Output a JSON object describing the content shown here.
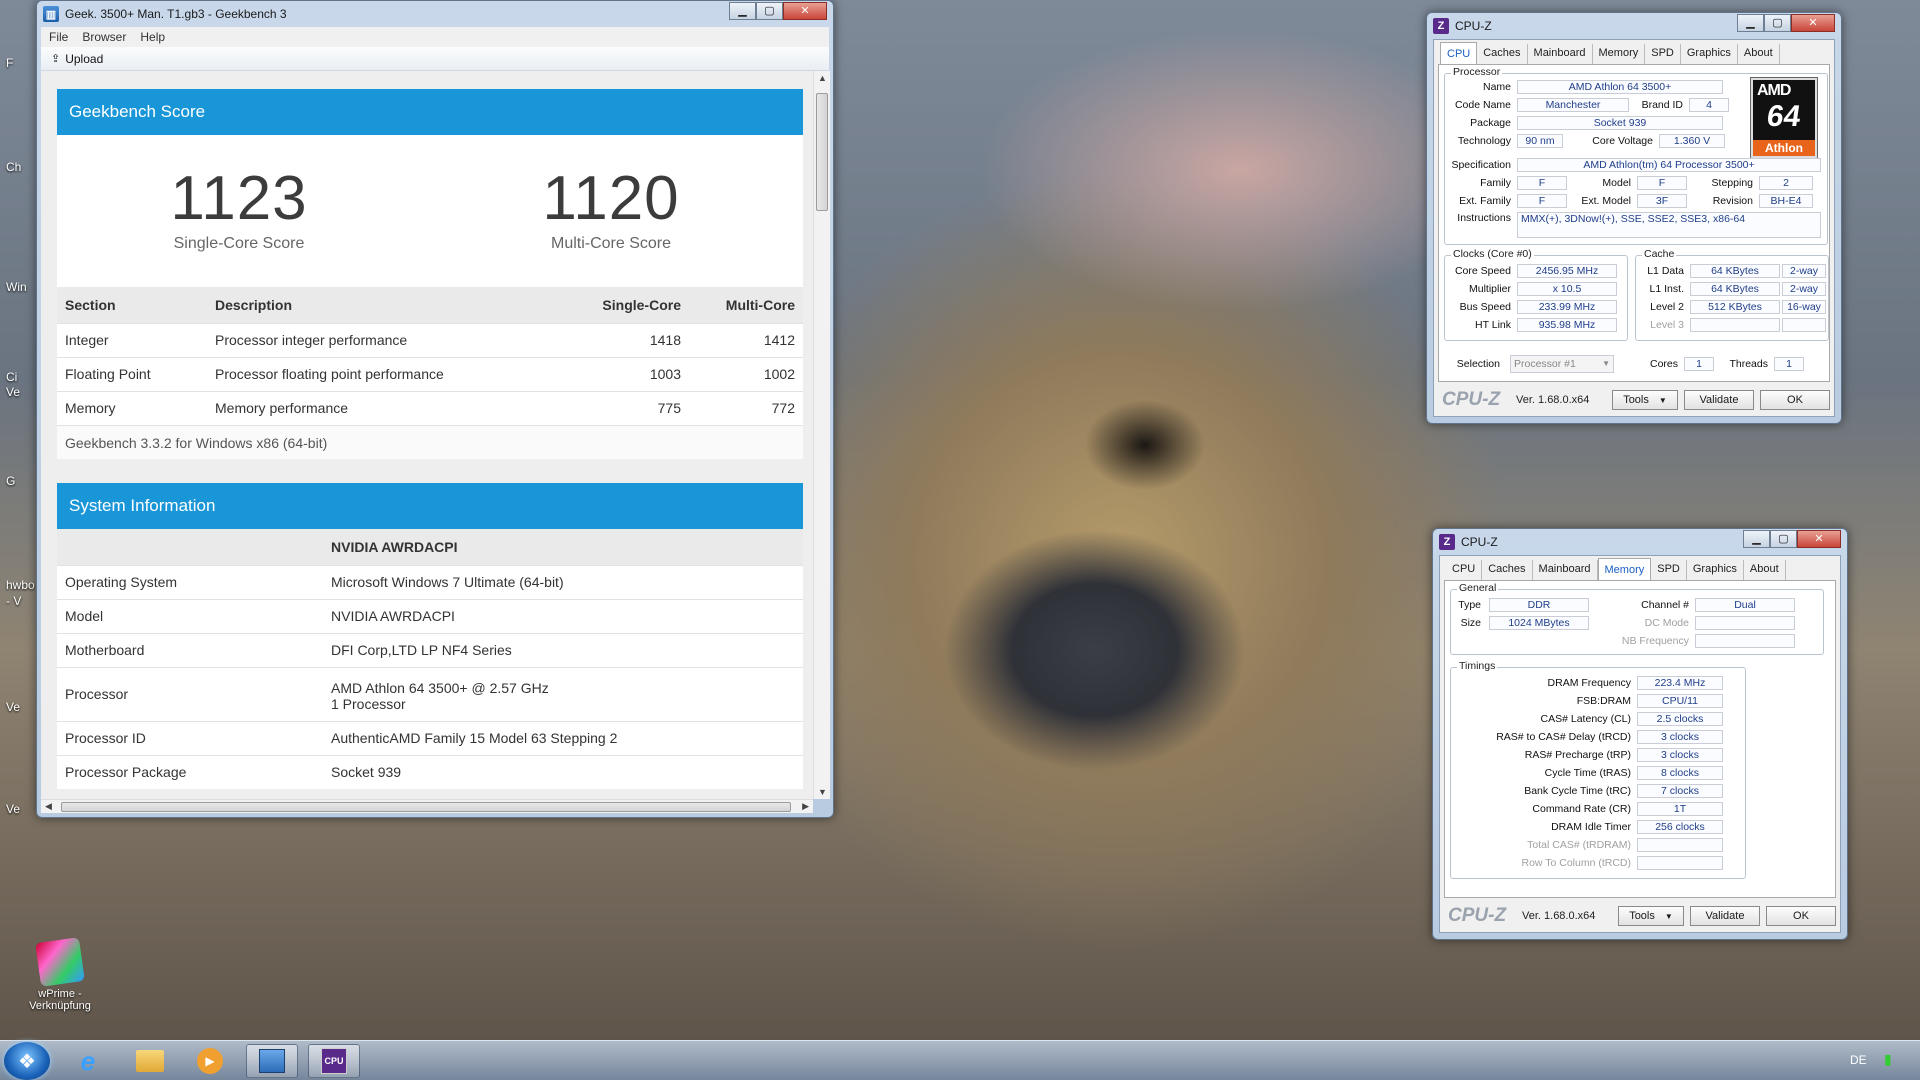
{
  "desktop": {
    "icon_label": "wPrime - Verknüpfung",
    "left_edge_fragments": [
      "F",
      "Ch",
      "Win",
      "Ci",
      "Ve",
      "G",
      "hwbo",
      "- V",
      "Ve",
      "Ve"
    ]
  },
  "geekbench": {
    "title": "Geek. 3500+ Man. T1.gb3 - Geekbench 3",
    "menu": [
      "File",
      "Browser",
      "Help"
    ],
    "toolbar_upload": "Upload",
    "score_card": {
      "header": "Geekbench Score",
      "single_score": "1123",
      "single_label": "Single-Core Score",
      "multi_score": "1120",
      "multi_label": "Multi-Core Score",
      "columns": [
        "Section",
        "Description",
        "Single-Core",
        "Multi-Core"
      ],
      "rows": [
        {
          "section": "Integer",
          "description": "Processor integer performance",
          "single": "1418",
          "multi": "1412"
        },
        {
          "section": "Floating Point",
          "description": "Processor floating point performance",
          "single": "1003",
          "multi": "1002"
        },
        {
          "section": "Memory",
          "description": "Memory performance",
          "single": "775",
          "multi": "772"
        }
      ],
      "footnote": "Geekbench 3.3.2 for Windows x86 (64-bit)"
    },
    "sysinfo": {
      "header": "System Information",
      "machine": "NVIDIA AWRDACPI",
      "rows": [
        {
          "key": "Operating System",
          "value": "Microsoft Windows 7 Ultimate (64-bit)",
          "value2": ""
        },
        {
          "key": "Model",
          "value": "NVIDIA AWRDACPI",
          "value2": ""
        },
        {
          "key": "Motherboard",
          "value": "DFI Corp,LTD LP NF4 Series",
          "value2": ""
        },
        {
          "key": "Processor",
          "value": "AMD Athlon 64 3500+ @ 2.57 GHz",
          "value2": "1 Processor"
        },
        {
          "key": "Processor ID",
          "value": "AuthenticAMD Family 15 Model 63 Stepping 2",
          "value2": ""
        },
        {
          "key": "Processor Package",
          "value": "Socket 939",
          "value2": ""
        }
      ]
    }
  },
  "cpuz_common": {
    "title": "CPU-Z",
    "tabs": [
      "CPU",
      "Caches",
      "Mainboard",
      "Memory",
      "SPD",
      "Graphics",
      "About"
    ],
    "brand": "CPU-Z",
    "version": "Ver. 1.68.0.x64",
    "tools": "Tools",
    "validate": "Validate",
    "ok": "OK"
  },
  "cpuz_cpu": {
    "processor_group": "Processor",
    "name_label": "Name",
    "name": "AMD Athlon 64 3500+",
    "codename_label": "Code Name",
    "codename": "Manchester",
    "brandid_label": "Brand ID",
    "brandid": "4",
    "package_label": "Package",
    "package": "Socket 939",
    "technology_label": "Technology",
    "technology": "90 nm",
    "voltage_label": "Core Voltage",
    "voltage": "1.360 V",
    "spec_label": "Specification",
    "spec": "AMD Athlon(tm) 64 Processor 3500+",
    "family_label": "Family",
    "family": "F",
    "model_label": "Model",
    "model": "F",
    "stepping_label": "Stepping",
    "stepping": "2",
    "extfamily_label": "Ext. Family",
    "extfamily": "F",
    "extmodel_label": "Ext. Model",
    "extmodel": "3F",
    "revision_label": "Revision",
    "revision": "BH-E4",
    "instructions_label": "Instructions",
    "instructions": "MMX(+), 3DNow!(+), SSE, SSE2, SSE3, x86-64",
    "logo_top": "AMD",
    "logo_num": "64",
    "logo_bottom": "Athlon",
    "clocks_group": "Clocks (Core #0)",
    "corespeed_label": "Core Speed",
    "corespeed": "2456.95 MHz",
    "multiplier_label": "Multiplier",
    "multiplier": "x 10.5",
    "busspeed_label": "Bus Speed",
    "busspeed": "233.99 MHz",
    "htlink_label": "HT Link",
    "htlink": "935.98 MHz",
    "cache_group": "Cache",
    "l1d_label": "L1 Data",
    "l1d": "64 KBytes",
    "l1d_way": "2-way",
    "l1i_label": "L1 Inst.",
    "l1i": "64 KBytes",
    "l1i_way": "2-way",
    "l2_label": "Level 2",
    "l2": "512 KBytes",
    "l2_way": "16-way",
    "l3_label": "Level 3",
    "selection_label": "Selection",
    "selection": "Processor #1",
    "cores_label": "Cores",
    "cores": "1",
    "threads_label": "Threads",
    "threads": "1"
  },
  "cpuz_mem": {
    "general_group": "General",
    "type_label": "Type",
    "type": "DDR",
    "size_label": "Size",
    "size": "1024 MBytes",
    "channel_label": "Channel #",
    "channel": "Dual",
    "dcmode_label": "DC Mode",
    "nbfreq_label": "NB Frequency",
    "timings_group": "Timings",
    "timings": [
      {
        "label": "DRAM Frequency",
        "value": "223.4 MHz",
        "dim": false
      },
      {
        "label": "FSB:DRAM",
        "value": "CPU/11",
        "dim": false
      },
      {
        "label": "CAS# Latency (CL)",
        "value": "2.5 clocks",
        "dim": false
      },
      {
        "label": "RAS# to CAS# Delay (tRCD)",
        "value": "3 clocks",
        "dim": false
      },
      {
        "label": "RAS# Precharge (tRP)",
        "value": "3 clocks",
        "dim": false
      },
      {
        "label": "Cycle Time (tRAS)",
        "value": "8 clocks",
        "dim": false
      },
      {
        "label": "Bank Cycle Time (tRC)",
        "value": "7 clocks",
        "dim": false
      },
      {
        "label": "Command Rate (CR)",
        "value": "1T",
        "dim": false
      },
      {
        "label": "DRAM Idle Timer",
        "value": "256 clocks",
        "dim": false
      },
      {
        "label": "Total CAS# (tRDRAM)",
        "value": "",
        "dim": true
      },
      {
        "label": "Row To Column (tRCD)",
        "value": "",
        "dim": true
      }
    ]
  },
  "taskbar": {
    "language": "DE"
  },
  "colors": {
    "accent_blue": "#1996d8",
    "cpuz_value_text": "#1f3e8a",
    "amd_orange": "#e8641b"
  }
}
